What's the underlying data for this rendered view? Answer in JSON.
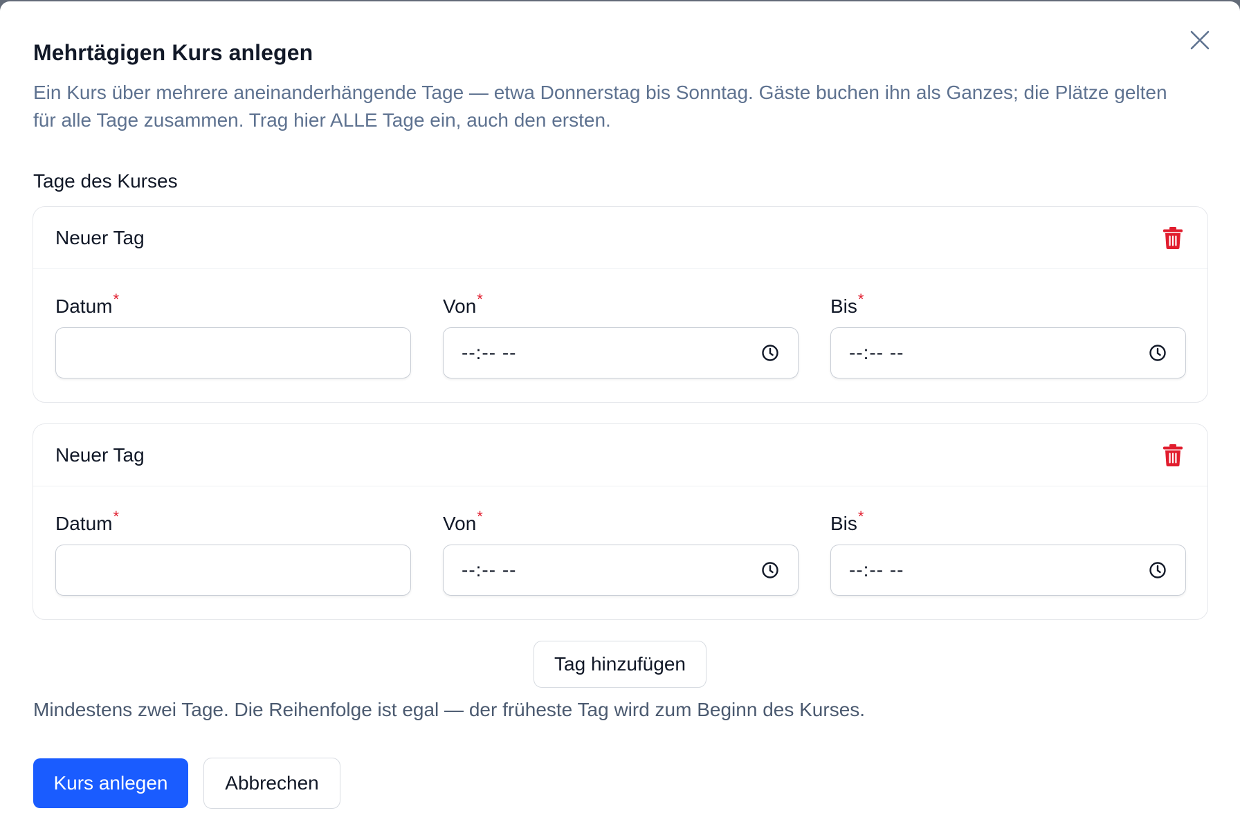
{
  "dialog": {
    "title": "Mehrtägigen Kurs anlegen",
    "description": "Ein Kurs über mehrere aneinanderhängende Tage — etwa Donnerstag bis Sonntag. Gäste buchen ihn als Ganzes; die Plätze gelten für alle Tage zusammen. Trag hier ALLE Tage ein, auch den ersten.",
    "close_icon": "close-icon"
  },
  "days_section": {
    "label": "Tage des Kurses",
    "days": [
      {
        "title": "Neuer Tag",
        "delete_icon": "trash-icon",
        "date": {
          "label": "Datum",
          "required_mark": "*",
          "value": ""
        },
        "from": {
          "label": "Von",
          "required_mark": "*",
          "value": "--:-- --"
        },
        "to": {
          "label": "Bis",
          "required_mark": "*",
          "value": "--:-- --"
        }
      },
      {
        "title": "Neuer Tag",
        "delete_icon": "trash-icon",
        "date": {
          "label": "Datum",
          "required_mark": "*",
          "value": ""
        },
        "from": {
          "label": "Von",
          "required_mark": "*",
          "value": "--:-- --"
        },
        "to": {
          "label": "Bis",
          "required_mark": "*",
          "value": "--:-- --"
        }
      }
    ],
    "add_day_label": "Tag hinzufügen",
    "hint": "Mindestens zwei Tage. Die Reihenfolge ist egal — der früheste Tag wird zum Beginn des Kurses."
  },
  "actions": {
    "submit_label": "Kurs anlegen",
    "cancel_label": "Abbrechen"
  },
  "colors": {
    "primary": "#1a5cff",
    "danger": "#e11d2e",
    "muted_text": "#5e7290"
  }
}
